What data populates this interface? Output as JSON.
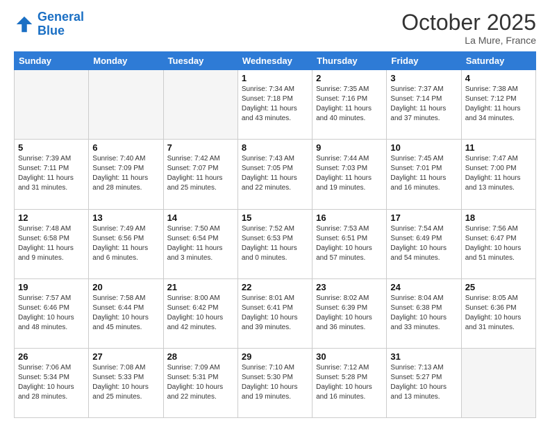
{
  "header": {
    "logo_line1": "General",
    "logo_line2": "Blue",
    "month": "October 2025",
    "location": "La Mure, France"
  },
  "weekdays": [
    "Sunday",
    "Monday",
    "Tuesday",
    "Wednesday",
    "Thursday",
    "Friday",
    "Saturday"
  ],
  "weeks": [
    [
      {
        "day": "",
        "info": ""
      },
      {
        "day": "",
        "info": ""
      },
      {
        "day": "",
        "info": ""
      },
      {
        "day": "1",
        "info": "Sunrise: 7:34 AM\nSunset: 7:18 PM\nDaylight: 11 hours\nand 43 minutes."
      },
      {
        "day": "2",
        "info": "Sunrise: 7:35 AM\nSunset: 7:16 PM\nDaylight: 11 hours\nand 40 minutes."
      },
      {
        "day": "3",
        "info": "Sunrise: 7:37 AM\nSunset: 7:14 PM\nDaylight: 11 hours\nand 37 minutes."
      },
      {
        "day": "4",
        "info": "Sunrise: 7:38 AM\nSunset: 7:12 PM\nDaylight: 11 hours\nand 34 minutes."
      }
    ],
    [
      {
        "day": "5",
        "info": "Sunrise: 7:39 AM\nSunset: 7:11 PM\nDaylight: 11 hours\nand 31 minutes."
      },
      {
        "day": "6",
        "info": "Sunrise: 7:40 AM\nSunset: 7:09 PM\nDaylight: 11 hours\nand 28 minutes."
      },
      {
        "day": "7",
        "info": "Sunrise: 7:42 AM\nSunset: 7:07 PM\nDaylight: 11 hours\nand 25 minutes."
      },
      {
        "day": "8",
        "info": "Sunrise: 7:43 AM\nSunset: 7:05 PM\nDaylight: 11 hours\nand 22 minutes."
      },
      {
        "day": "9",
        "info": "Sunrise: 7:44 AM\nSunset: 7:03 PM\nDaylight: 11 hours\nand 19 minutes."
      },
      {
        "day": "10",
        "info": "Sunrise: 7:45 AM\nSunset: 7:01 PM\nDaylight: 11 hours\nand 16 minutes."
      },
      {
        "day": "11",
        "info": "Sunrise: 7:47 AM\nSunset: 7:00 PM\nDaylight: 11 hours\nand 13 minutes."
      }
    ],
    [
      {
        "day": "12",
        "info": "Sunrise: 7:48 AM\nSunset: 6:58 PM\nDaylight: 11 hours\nand 9 minutes."
      },
      {
        "day": "13",
        "info": "Sunrise: 7:49 AM\nSunset: 6:56 PM\nDaylight: 11 hours\nand 6 minutes."
      },
      {
        "day": "14",
        "info": "Sunrise: 7:50 AM\nSunset: 6:54 PM\nDaylight: 11 hours\nand 3 minutes."
      },
      {
        "day": "15",
        "info": "Sunrise: 7:52 AM\nSunset: 6:53 PM\nDaylight: 11 hours\nand 0 minutes."
      },
      {
        "day": "16",
        "info": "Sunrise: 7:53 AM\nSunset: 6:51 PM\nDaylight: 10 hours\nand 57 minutes."
      },
      {
        "day": "17",
        "info": "Sunrise: 7:54 AM\nSunset: 6:49 PM\nDaylight: 10 hours\nand 54 minutes."
      },
      {
        "day": "18",
        "info": "Sunrise: 7:56 AM\nSunset: 6:47 PM\nDaylight: 10 hours\nand 51 minutes."
      }
    ],
    [
      {
        "day": "19",
        "info": "Sunrise: 7:57 AM\nSunset: 6:46 PM\nDaylight: 10 hours\nand 48 minutes."
      },
      {
        "day": "20",
        "info": "Sunrise: 7:58 AM\nSunset: 6:44 PM\nDaylight: 10 hours\nand 45 minutes."
      },
      {
        "day": "21",
        "info": "Sunrise: 8:00 AM\nSunset: 6:42 PM\nDaylight: 10 hours\nand 42 minutes."
      },
      {
        "day": "22",
        "info": "Sunrise: 8:01 AM\nSunset: 6:41 PM\nDaylight: 10 hours\nand 39 minutes."
      },
      {
        "day": "23",
        "info": "Sunrise: 8:02 AM\nSunset: 6:39 PM\nDaylight: 10 hours\nand 36 minutes."
      },
      {
        "day": "24",
        "info": "Sunrise: 8:04 AM\nSunset: 6:38 PM\nDaylight: 10 hours\nand 33 minutes."
      },
      {
        "day": "25",
        "info": "Sunrise: 8:05 AM\nSunset: 6:36 PM\nDaylight: 10 hours\nand 31 minutes."
      }
    ],
    [
      {
        "day": "26",
        "info": "Sunrise: 7:06 AM\nSunset: 5:34 PM\nDaylight: 10 hours\nand 28 minutes."
      },
      {
        "day": "27",
        "info": "Sunrise: 7:08 AM\nSunset: 5:33 PM\nDaylight: 10 hours\nand 25 minutes."
      },
      {
        "day": "28",
        "info": "Sunrise: 7:09 AM\nSunset: 5:31 PM\nDaylight: 10 hours\nand 22 minutes."
      },
      {
        "day": "29",
        "info": "Sunrise: 7:10 AM\nSunset: 5:30 PM\nDaylight: 10 hours\nand 19 minutes."
      },
      {
        "day": "30",
        "info": "Sunrise: 7:12 AM\nSunset: 5:28 PM\nDaylight: 10 hours\nand 16 minutes."
      },
      {
        "day": "31",
        "info": "Sunrise: 7:13 AM\nSunset: 5:27 PM\nDaylight: 10 hours\nand 13 minutes."
      },
      {
        "day": "",
        "info": ""
      }
    ]
  ]
}
